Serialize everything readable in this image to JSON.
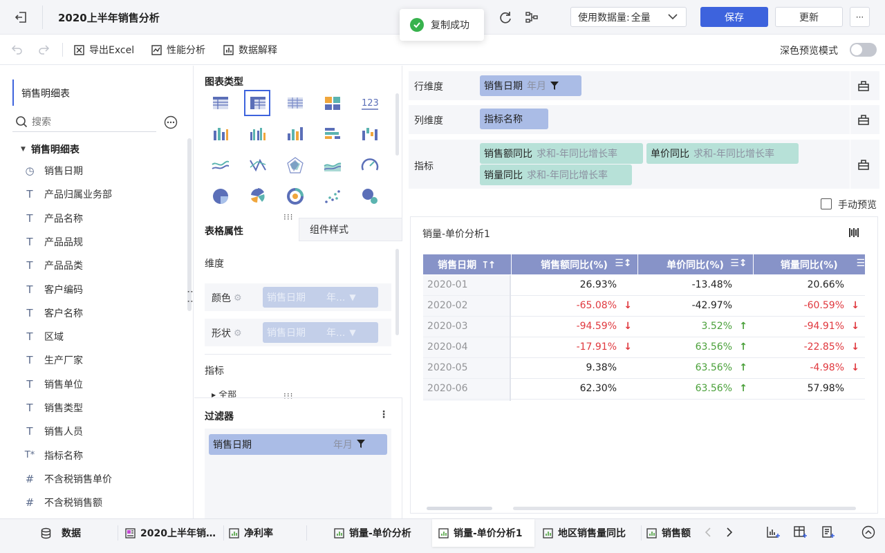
{
  "header": {
    "title": "2020上半年销售分析",
    "data_usage_label": "使用数据量:",
    "data_usage_value": "全量",
    "save_label": "保存",
    "update_label": "更新",
    "more_label": "···"
  },
  "toast": {
    "text": "复制成功"
  },
  "toolbar": {
    "export_label": "导出Excel",
    "perf_label": "性能分析",
    "explain_label": "数据解释",
    "dark_preview_label": "深色预览模式"
  },
  "left": {
    "dataset_name": "销售明细表",
    "search_placeholder": "搜索",
    "tree_root": "销售明细表",
    "fields": [
      {
        "icon": "clock-icon",
        "glyph": "◷",
        "label": "销售日期"
      },
      {
        "icon": "text-icon",
        "glyph": "T",
        "label": "产品归属业务部"
      },
      {
        "icon": "text-icon",
        "glyph": "T",
        "label": "产品名称"
      },
      {
        "icon": "text-icon",
        "glyph": "T",
        "label": "产品品规"
      },
      {
        "icon": "text-icon",
        "glyph": "T",
        "label": "产品品类"
      },
      {
        "icon": "text-icon",
        "glyph": "T",
        "label": "客户编码"
      },
      {
        "icon": "text-icon",
        "glyph": "T",
        "label": "客户名称"
      },
      {
        "icon": "text-icon",
        "glyph": "T",
        "label": "区域"
      },
      {
        "icon": "text-icon",
        "glyph": "T",
        "label": "生产厂家"
      },
      {
        "icon": "text-icon",
        "glyph": "T",
        "label": "销售单位"
      },
      {
        "icon": "text-icon",
        "glyph": "T",
        "label": "销售类型"
      },
      {
        "icon": "text-icon",
        "glyph": "T",
        "label": "销售人员"
      },
      {
        "icon": "text-calc-icon",
        "glyph": "T*",
        "label": "指标名称"
      },
      {
        "icon": "number-icon",
        "glyph": "#",
        "label": "不含税销售单价"
      },
      {
        "icon": "number-icon",
        "glyph": "#",
        "label": "不含税销售额"
      }
    ]
  },
  "mid": {
    "chart_type_title": "图表类型",
    "tab_table_props": "表格属性",
    "tab_component_style": "组件样式",
    "dimension_label": "维度",
    "color_label": "颜色",
    "shape_label": "形状",
    "placeholder_field": "销售日期",
    "placeholder_sub": "年...",
    "metric_label": "指标",
    "all_label": "全部",
    "filter_title": "过滤器",
    "filter_field": "销售日期",
    "filter_sub": "年月"
  },
  "right": {
    "row_dim_label": "行维度",
    "row_dim_field": "销售日期",
    "row_dim_sub": "年月",
    "col_dim_label": "列维度",
    "col_dim_field": "指标名称",
    "metric_label": "指标",
    "metrics": [
      {
        "name": "销售额同比",
        "sub": "求和-年同比增长率"
      },
      {
        "name": "单价同比",
        "sub": "求和-年同比增长率"
      },
      {
        "name": "销量同比",
        "sub": "求和-年同比增长率"
      }
    ],
    "manual_preview_label": "手动预览",
    "widget_title": "销量-单价分析1",
    "table": {
      "headers": [
        "销售日期",
        "销售额同比(%)",
        "单价同比(%)",
        "销量同比(%)"
      ],
      "rows": [
        {
          "date": "2020-01",
          "c1": "26.93%",
          "c1t": "",
          "c2": "-13.48%",
          "c2t": "",
          "c3": "20.66%",
          "c3t": ""
        },
        {
          "date": "2020-02",
          "c1": "-65.08%",
          "c1t": "down",
          "c2": "-42.97%",
          "c2t": "",
          "c3": "-60.59%",
          "c3t": "down"
        },
        {
          "date": "2020-03",
          "c1": "-94.59%",
          "c1t": "down",
          "c2": "3.52%",
          "c2t": "up",
          "c3": "-94.91%",
          "c3t": "down"
        },
        {
          "date": "2020-04",
          "c1": "-17.91%",
          "c1t": "down",
          "c2": "63.56%",
          "c2t": "up",
          "c3": "-22.85%",
          "c3t": "down"
        },
        {
          "date": "2020-05",
          "c1": "9.38%",
          "c1t": "",
          "c2": "63.56%",
          "c2t": "up",
          "c3": "-4.98%",
          "c3t": "down"
        },
        {
          "date": "2020-06",
          "c1": "62.30%",
          "c1t": "",
          "c2": "63.56%",
          "c2t": "up",
          "c3": "57.98%",
          "c3t": ""
        }
      ]
    }
  },
  "bottom": {
    "data_label": "数据",
    "tabs": [
      "2020上半年销…",
      "净利率",
      "销量-单价分析",
      "销量-单价分析1",
      "地区销售量同比",
      "销售额"
    ]
  },
  "colors": {
    "primary": "#3d63dd",
    "header_table": "#8793c8",
    "negative": "#e0383e",
    "positive": "#4aa03a",
    "pill_blue": "#aabce6",
    "pill_green": "#b7e1d8"
  }
}
